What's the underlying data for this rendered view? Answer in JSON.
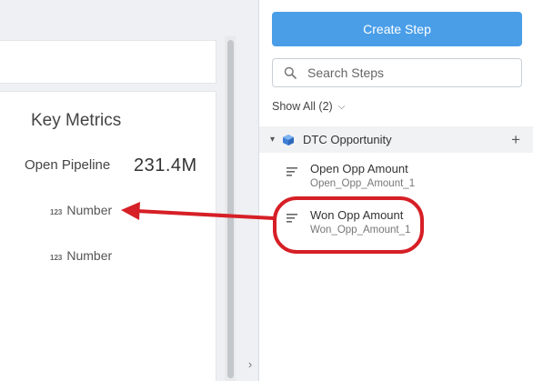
{
  "canvas": {
    "widget": {
      "title": "Key Metrics",
      "metric_label": "Open Pipeline",
      "metric_value": "231.4M",
      "number_placeholders": [
        {
          "icon": "123",
          "label": "Number"
        },
        {
          "icon": "123",
          "label": "Number"
        }
      ]
    },
    "collapse_glyph": "›"
  },
  "panel": {
    "create_step_label": "Create Step",
    "search_placeholder": "Search Steps",
    "show_all_label": "Show All (2)",
    "show_all_chevron": "⌵",
    "dataset": {
      "caret": "▾",
      "name": "DTC Opportunity",
      "add_glyph": "+"
    },
    "fields": [
      {
        "name": "Open Opp Amount",
        "api_name": "Open_Opp_Amount_1"
      },
      {
        "name": "Won Opp Amount",
        "api_name": "Won_Opp_Amount_1"
      }
    ]
  },
  "colors": {
    "accent": "#4a9ee8",
    "annotation": "#d61f26"
  },
  "icons": [
    "search-icon",
    "cube-icon",
    "text-lines-icon",
    "chevron-right-icon",
    "plus-icon"
  ]
}
